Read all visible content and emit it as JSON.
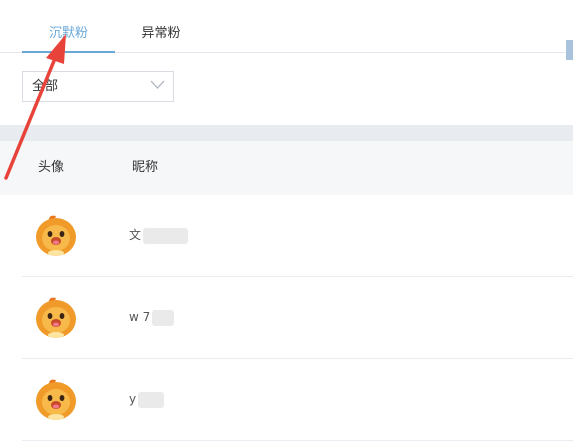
{
  "tabs": [
    {
      "label": "沉默粉",
      "active": true
    },
    {
      "label": "异常粉",
      "active": false
    }
  ],
  "filter": {
    "selected": "全部"
  },
  "table": {
    "columns": [
      "头像",
      "昵称"
    ],
    "rows": [
      {
        "nickname_visible": "文"
      },
      {
        "nickname_visible": "w 7"
      },
      {
        "nickname_visible": "y"
      }
    ]
  },
  "colors": {
    "accent": "#6aa8d8",
    "annotation_arrow": "#e8433a",
    "band": "#e8ecf1",
    "header_bg": "#f6f7f9"
  },
  "icons": {
    "filter_chevron": "chevron-down-icon",
    "avatar": "orange-mascot-avatar",
    "annotation": "red-arrow"
  }
}
